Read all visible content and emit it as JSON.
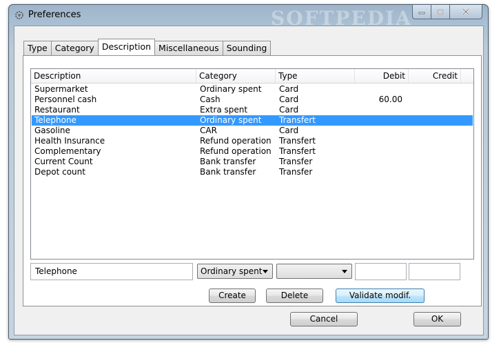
{
  "window": {
    "title": "Preferences",
    "watermark": "SOFTPEDIA"
  },
  "tabs": [
    {
      "label": "Type"
    },
    {
      "label": "Category"
    },
    {
      "label": "Description",
      "active": true
    },
    {
      "label": "Miscellaneous"
    },
    {
      "label": "Sounding"
    }
  ],
  "list": {
    "columns": [
      "Description",
      "Category",
      "Type",
      "Debit",
      "Credit"
    ],
    "rows": [
      {
        "description": "Supermarket",
        "category": "Ordinary spent",
        "type": "Card",
        "debit": "",
        "credit": ""
      },
      {
        "description": "Personnel cash",
        "category": "Cash",
        "type": "Card",
        "debit": "60.00",
        "credit": ""
      },
      {
        "description": "Restaurant",
        "category": "Extra spent",
        "type": "Card",
        "debit": "",
        "credit": ""
      },
      {
        "description": "Telephone",
        "category": "Ordinary spent",
        "type": "Transfert",
        "debit": "",
        "credit": ""
      },
      {
        "description": "Gasoline",
        "category": "CAR",
        "type": "Card",
        "debit": "",
        "credit": ""
      },
      {
        "description": "Health Insurance",
        "category": "Refund operation",
        "type": "Transfert",
        "debit": "",
        "credit": ""
      },
      {
        "description": "Complementary",
        "category": "Refund operation",
        "type": "Transfert",
        "debit": "",
        "credit": ""
      },
      {
        "description": "Current Count",
        "category": "Bank transfer",
        "type": "Transfer",
        "debit": "",
        "credit": ""
      },
      {
        "description": "Depot count",
        "category": "Bank transfer",
        "type": "Transfer",
        "debit": "",
        "credit": ""
      }
    ],
    "selected_index": 3,
    "selection_color": "#3399ff"
  },
  "editor": {
    "description_value": "Telephone",
    "category_value": "Ordinary spent",
    "type_value": "",
    "debit_value": "",
    "credit_value": ""
  },
  "buttons": {
    "create": "Create",
    "delete": "Delete",
    "validate": "Validate modif.",
    "cancel": "Cancel",
    "ok": "OK"
  },
  "icons": {
    "app": "preferences-gear-icon",
    "minimize": "minimize-icon",
    "maximize": "maximize-icon",
    "close": "close-icon",
    "dropdown": "chevron-down-icon"
  }
}
